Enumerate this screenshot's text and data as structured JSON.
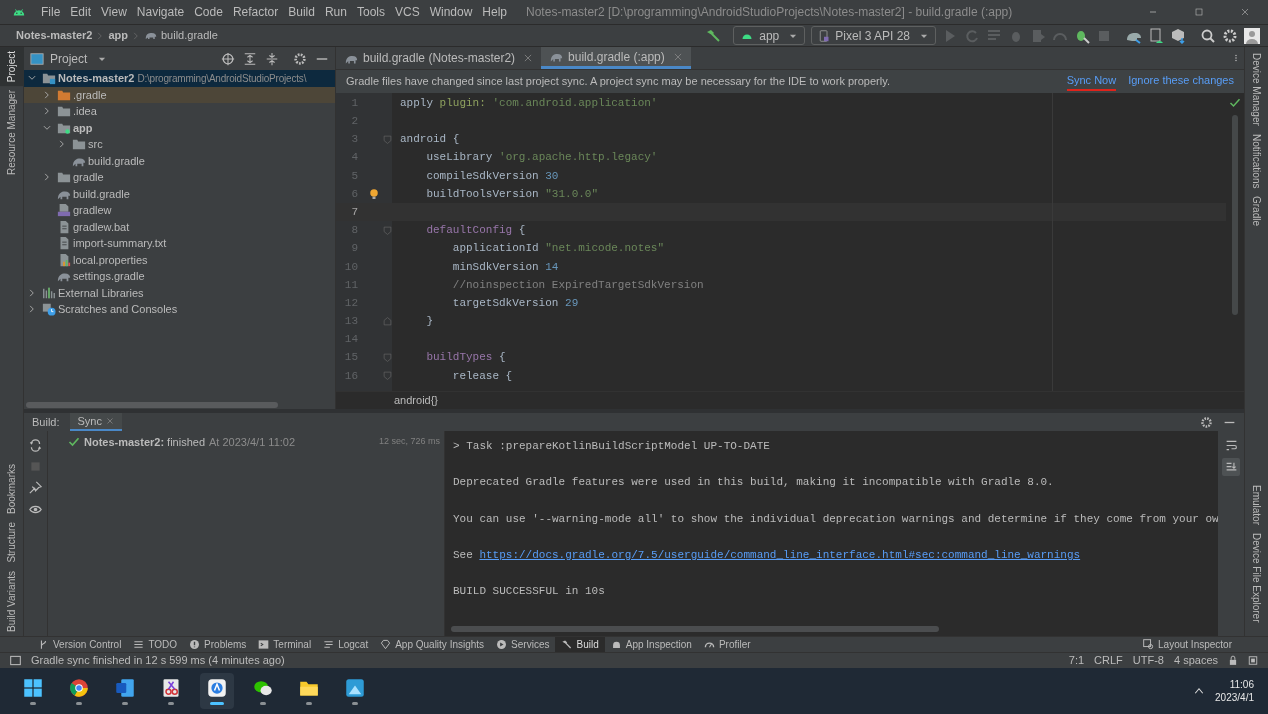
{
  "menu": [
    "File",
    "Edit",
    "View",
    "Navigate",
    "Code",
    "Refactor",
    "Build",
    "Run",
    "Tools",
    "VCS",
    "Window",
    "Help"
  ],
  "window_title": "Notes-master2 [D:\\programming\\AndroidStudioProjects\\Notes-master2] - build.gradle (:app)",
  "breadcrumbs": [
    "Notes-master2",
    "app",
    "build.gradle"
  ],
  "toolbar": {
    "run_config": "app",
    "device": "Pixel 3 API 28"
  },
  "left_tool_tabs": [
    {
      "label": "Project",
      "selected": true
    },
    {
      "label": "Resource Manager",
      "selected": false
    }
  ],
  "left_bottom_tool_tabs": [
    {
      "label": "Bookmarks",
      "selected": false
    },
    {
      "label": "Structure",
      "selected": false
    },
    {
      "label": "Build Variants",
      "selected": false
    }
  ],
  "right_tool_tabs": [
    {
      "label": "Device Manager",
      "selected": false
    },
    {
      "label": "Notifications",
      "selected": false
    },
    {
      "label": "Gradle",
      "selected": false
    }
  ],
  "right_bottom_tool_tabs": [
    {
      "label": "Emulator",
      "selected": false
    },
    {
      "label": "Device File Explorer",
      "selected": false
    }
  ],
  "project_panel": {
    "title": "Project",
    "tree": [
      {
        "label": "Notes-master2",
        "path": "D:\\programming\\AndroidStudioProjects\\",
        "kind": "project",
        "expanded": true,
        "selected": true,
        "children": [
          {
            "label": ".gradle",
            "kind": "excluded-folder",
            "expanded": false,
            "selected": false
          },
          {
            "label": ".idea",
            "kind": "folder",
            "expanded": false,
            "selected": false
          },
          {
            "label": "app",
            "kind": "module",
            "expanded": true,
            "selected": false,
            "children": [
              {
                "label": "src",
                "kind": "folder",
                "expanded": false,
                "selected": false
              },
              {
                "label": "build.gradle",
                "kind": "gradle",
                "selected": false
              }
            ]
          },
          {
            "label": "gradle",
            "kind": "folder",
            "expanded": false,
            "selected": false
          },
          {
            "label": "build.gradle",
            "kind": "gradle",
            "selected": false
          },
          {
            "label": "gradlew",
            "kind": "script",
            "selected": false
          },
          {
            "label": "gradlew.bat",
            "kind": "file",
            "selected": false
          },
          {
            "label": "import-summary.txt",
            "kind": "file",
            "selected": false
          },
          {
            "label": "local.properties",
            "kind": "properties",
            "selected": false
          },
          {
            "label": "settings.gradle",
            "kind": "gradle",
            "selected": false
          }
        ]
      },
      {
        "label": "External Libraries",
        "kind": "libraries",
        "expanded": false,
        "selected": false
      },
      {
        "label": "Scratches and Consoles",
        "kind": "scratches",
        "expanded": false,
        "selected": false
      }
    ]
  },
  "editor_tabs": [
    {
      "label": "build.gradle (Notes-master2)",
      "selected": false
    },
    {
      "label": "build.gradle (:app)",
      "selected": true
    }
  ],
  "notification": {
    "message": "Gradle files have changed since last project sync. A project sync may be necessary for the IDE to work properly.",
    "actions": [
      {
        "label": "Sync Now",
        "marked": true
      },
      {
        "label": "Ignore these changes",
        "marked": false
      }
    ]
  },
  "code_lines": [
    {
      "number": "1",
      "current": false,
      "kind": "plain",
      "tokens": [
        {
          "kind": "plain",
          "text": "apply "
        },
        {
          "kind": "named-arg",
          "text": "plugin:"
        },
        {
          "kind": "string",
          "text": " 'com.android.application'"
        }
      ]
    },
    {
      "number": "2",
      "current": false,
      "kind": "plain"
    },
    {
      "number": "3",
      "current": false,
      "kind": "fold-start",
      "tokens": [
        {
          "kind": "plain",
          "text": "android {"
        }
      ]
    },
    {
      "number": "4",
      "current": false,
      "kind": "plain",
      "tokens": [
        {
          "kind": "plain",
          "text": "    useLibrary "
        },
        {
          "kind": "string",
          "text": "'org.apache.http.legacy'"
        }
      ]
    },
    {
      "number": "5",
      "current": false,
      "kind": "plain",
      "tokens": [
        {
          "kind": "plain",
          "text": "    compileSdkVersion "
        },
        {
          "kind": "number",
          "text": "30"
        }
      ]
    },
    {
      "number": "6",
      "current": false,
      "kind": "bulb",
      "tokens": [
        {
          "kind": "plain",
          "text": "    buildToolsVersion "
        },
        {
          "kind": "string",
          "text": "\"31.0.0\""
        }
      ]
    },
    {
      "number": "7",
      "current": true,
      "kind": "plain"
    },
    {
      "number": "8",
      "current": false,
      "kind": "fold-start",
      "tokens": [
        {
          "kind": "keyword",
          "text": "    defaultConfig"
        },
        {
          "kind": "plain",
          "text": " {"
        }
      ]
    },
    {
      "number": "9",
      "current": false,
      "kind": "plain",
      "tokens": [
        {
          "kind": "plain",
          "text": "        applicationId "
        },
        {
          "kind": "string",
          "text": "\"net.micode.notes\""
        }
      ]
    },
    {
      "number": "10",
      "current": false,
      "kind": "plain",
      "tokens": [
        {
          "kind": "plain",
          "text": "        minSdkVersion "
        },
        {
          "kind": "number",
          "text": "14"
        }
      ]
    },
    {
      "number": "11",
      "current": false,
      "kind": "plain",
      "tokens": [
        {
          "kind": "comment",
          "text": "        //noinspection ExpiredTargetSdkVersion"
        }
      ]
    },
    {
      "number": "12",
      "current": false,
      "kind": "plain",
      "tokens": [
        {
          "kind": "plain",
          "text": "        targetSdkVersion "
        },
        {
          "kind": "number",
          "text": "29"
        }
      ]
    },
    {
      "number": "13",
      "current": false,
      "kind": "fold-end",
      "tokens": [
        {
          "kind": "plain",
          "text": "    }"
        }
      ]
    },
    {
      "number": "14",
      "current": false,
      "kind": "plain"
    },
    {
      "number": "15",
      "current": false,
      "kind": "fold-start",
      "tokens": [
        {
          "kind": "keyword",
          "text": "    buildTypes"
        },
        {
          "kind": "plain",
          "text": " {"
        }
      ]
    },
    {
      "number": "16",
      "current": false,
      "kind": "fold-start",
      "tokens": [
        {
          "kind": "plain",
          "text": "        release {"
        }
      ]
    }
  ],
  "editor_breadcrumb": "android{}",
  "build_panel": {
    "label": "Build:",
    "tabs": [
      {
        "label": "Sync",
        "selected": true
      }
    ],
    "results": [
      {
        "title": "Notes-master2:",
        "status": "finished",
        "time": "At 2023/4/1 11:02",
        "duration": "12 sec, 726 ms"
      }
    ],
    "console": [
      {
        "kind": "text",
        "text": "> Task :prepareKotlinBuildScriptModel UP-TO-DATE"
      },
      {
        "kind": "blank"
      },
      {
        "kind": "text",
        "text": "Deprecated Gradle features were used in this build, making it incompatible with Gradle 8.0."
      },
      {
        "kind": "blank"
      },
      {
        "kind": "text",
        "text": "You can use '--warning-mode all' to show the individual deprecation warnings and determine if they come from your ow"
      },
      {
        "kind": "blank"
      },
      {
        "kind": "link",
        "text": "See ",
        "link": "https://docs.gradle.org/7.5/userguide/command_line_interface.html#sec:command_line_warnings"
      },
      {
        "kind": "blank"
      },
      {
        "kind": "text",
        "text": "BUILD SUCCESSFUL in 10s"
      }
    ]
  },
  "bottom_tool_tabs": [
    {
      "label": "Version Control",
      "selected": false
    },
    {
      "label": "TODO",
      "selected": false
    },
    {
      "label": "Problems",
      "selected": false
    },
    {
      "label": "Terminal",
      "selected": false
    },
    {
      "label": "Logcat",
      "selected": false
    },
    {
      "label": "App Quality Insights",
      "selected": false
    },
    {
      "label": "Services",
      "selected": false
    },
    {
      "label": "Build",
      "selected": true
    },
    {
      "label": "App Inspection",
      "selected": false
    },
    {
      "label": "Profiler",
      "selected": false
    }
  ],
  "bottom_right_tool_tab": "Layout Inspector",
  "status_bar": {
    "message": "Gradle sync finished in 12 s 599 ms (4 minutes ago)",
    "items": [
      "7:1",
      "CRLF",
      "UTF-8",
      "4 spaces"
    ]
  },
  "taskbar": {
    "apps": [
      {
        "selected": false
      },
      {
        "selected": false
      },
      {
        "selected": false
      },
      {
        "selected": false
      },
      {
        "selected": true
      },
      {
        "selected": false
      },
      {
        "selected": false
      },
      {
        "selected": false
      }
    ],
    "time": "11:06",
    "date": "2023/4/1"
  }
}
